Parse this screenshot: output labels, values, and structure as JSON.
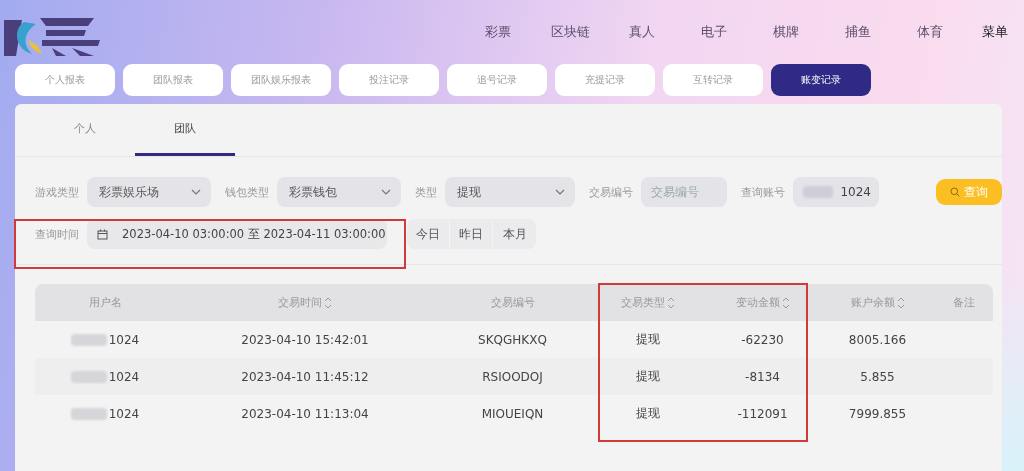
{
  "nav": [
    "彩票",
    "区块链",
    "真人",
    "电子",
    "棋牌",
    "捕鱼",
    "体育",
    "菜单"
  ],
  "report_tabs": [
    {
      "label": "个人报表",
      "selected": false
    },
    {
      "label": "团队报表",
      "selected": false
    },
    {
      "label": "团队娱乐报表",
      "selected": false
    },
    {
      "label": "投注记录",
      "selected": false
    },
    {
      "label": "追号记录",
      "selected": false
    },
    {
      "label": "充提记录",
      "selected": false
    },
    {
      "label": "互转记录",
      "selected": false
    },
    {
      "label": "账变记录",
      "selected": true
    }
  ],
  "sub_tabs": [
    {
      "label": "个人",
      "selected": false
    },
    {
      "label": "团队",
      "selected": true
    }
  ],
  "filters": [
    {
      "kind": "select",
      "label": "游戏类型",
      "value": "彩票娱乐场"
    },
    {
      "kind": "select",
      "label": "钱包类型",
      "value": "彩票钱包"
    },
    {
      "kind": "select",
      "label": "类型",
      "value": "提现"
    },
    {
      "kind": "input",
      "label": "交易编号",
      "placeholder": "交易编号"
    },
    {
      "kind": "input",
      "label": "查询账号",
      "value": "1024",
      "redacted": true
    }
  ],
  "query_button": "查询",
  "time_filter": {
    "label": "查询时间",
    "value": "2023-04-10 03:00:00 至 2023-04-11 03:00:00"
  },
  "quick_buttons": [
    "今日",
    "昨日",
    "本月"
  ],
  "table": {
    "columns": [
      {
        "label": "用户名",
        "sortable": false
      },
      {
        "label": "交易时间",
        "sortable": true
      },
      {
        "label": "交易编号",
        "sortable": false
      },
      {
        "label": "交易类型",
        "sortable": true
      },
      {
        "label": "变动金额",
        "sortable": true
      },
      {
        "label": "账户余额",
        "sortable": true
      },
      {
        "label": "备注",
        "sortable": false
      }
    ],
    "rows": [
      [
        "1024",
        "2023-04-10 15:42:01",
        "SKQGHKXQ",
        "提现",
        "-62230",
        "8005.166",
        ""
      ],
      [
        "1024",
        "2023-04-10 11:45:12",
        "RSIOODOJ",
        "提现",
        "-8134",
        "5.855",
        ""
      ],
      [
        "1024",
        "2023-04-10 11:13:04",
        "MIOUEIQN",
        "提现",
        "-112091",
        "7999.855",
        ""
      ]
    ]
  }
}
